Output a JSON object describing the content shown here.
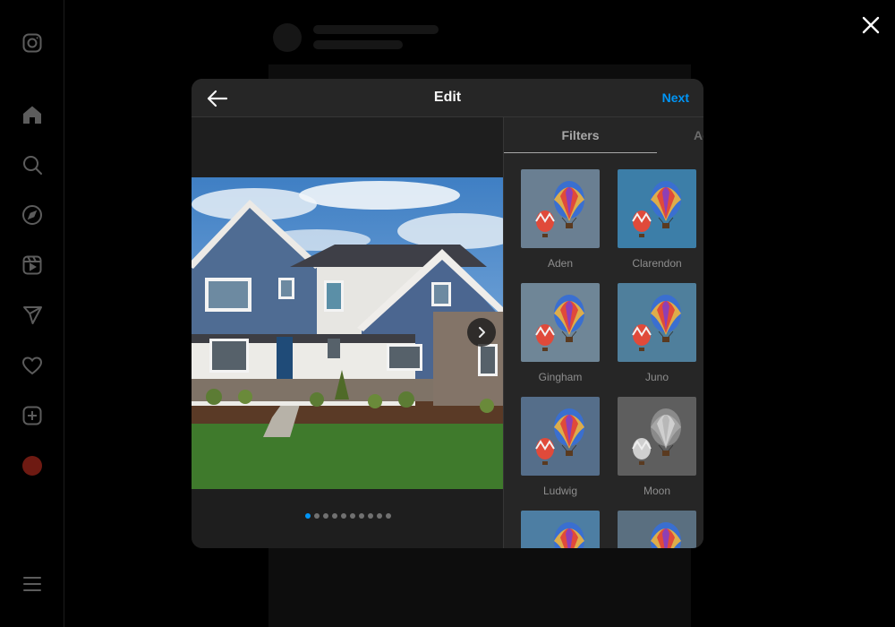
{
  "modal": {
    "title": "Edit",
    "next_label": "Next"
  },
  "tabs": {
    "filters": "Filters",
    "adjustments": "Adjustments"
  },
  "carousel": {
    "dot_count": 10,
    "active_index": 0
  },
  "filters": [
    {
      "name": "Aden",
      "tint": "#6a7f92"
    },
    {
      "name": "Clarendon",
      "tint": "#3c7ea8"
    },
    {
      "name": "Gingham",
      "tint": "#6f8697"
    },
    {
      "name": "Juno",
      "tint": "#4f7f9c"
    },
    {
      "name": "Ludwig",
      "tint": "#556e8a"
    },
    {
      "name": "Moon",
      "tint": "#5e5e5e"
    },
    {
      "name": "",
      "tint": "#4d7ea3"
    },
    {
      "name": "",
      "tint": "#5a6f80"
    }
  ],
  "sidebar": {
    "items": [
      "instagram-icon",
      "home-icon",
      "search-icon",
      "explore-icon",
      "reels-icon",
      "messages-icon",
      "notifications-icon",
      "create-icon",
      "profile-avatar",
      "more-menu-icon"
    ]
  }
}
